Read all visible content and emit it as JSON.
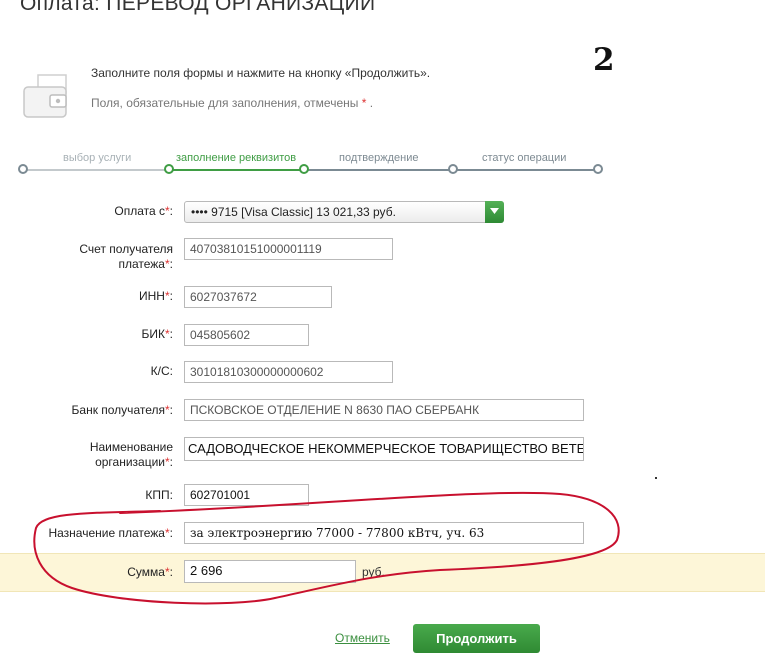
{
  "page": {
    "title": "Оплата: ПЕРЕВОД ОРГАНИЗАЦИИ",
    "step_number": "2",
    "intro": "Заполните поля формы и нажмите на кнопку «Продолжить».",
    "required_note": "Поля, обязательные для заполнения, отмечены",
    "required_mark": "*",
    "required_dot": "."
  },
  "steps": [
    {
      "label": "выбор услуги",
      "state": "done"
    },
    {
      "label": "заполнение реквизитов",
      "state": "active"
    },
    {
      "label": "подтверждение",
      "state": "pending"
    },
    {
      "label": "статус операции",
      "state": "pending"
    }
  ],
  "form": {
    "pay_from": {
      "label": "Оплата с",
      "value": "•••• 9715 [Visa Classic] 13 021,33 руб."
    },
    "account": {
      "label": "Счет получателя платежа",
      "value": "40703810151000001119"
    },
    "inn": {
      "label": "ИНН",
      "value": "6027037672"
    },
    "bik": {
      "label": "БИК",
      "value": "045805602"
    },
    "ks": {
      "label": "К/С",
      "value": "30101810300000000602"
    },
    "bank": {
      "label": "Банк получателя",
      "value": "ПСКОВСКОЕ ОТДЕЛЕНИЕ N 8630 ПАО СБЕРБАНК"
    },
    "org_name": {
      "label": "Наименование организации",
      "value": "САДОВОДЧЕСКОЕ НЕКОММЕРЧЕСКОЕ ТОВАРИЩЕСТВО ВЕТЕРАНЫ"
    },
    "kpp": {
      "label": "КПП",
      "value": "602701001"
    },
    "purpose": {
      "label": "Назначение платежа",
      "value": "за электроэнергию 77000 - 77800 кВтч, уч. 63"
    },
    "amount": {
      "label": "Сумма",
      "value": "2 696",
      "unit": "руб."
    }
  },
  "actions": {
    "cancel_label": "Отменить",
    "continue_label": "Продолжить"
  },
  "colors": {
    "accent_green": "#3f9d44",
    "required_red": "#d33333",
    "highlight_band": "#fdf6d8",
    "annotation_red": "#c8102e"
  },
  "icons": {
    "wallet": "wallet-icon",
    "dropdown": "chevron-down-icon"
  }
}
